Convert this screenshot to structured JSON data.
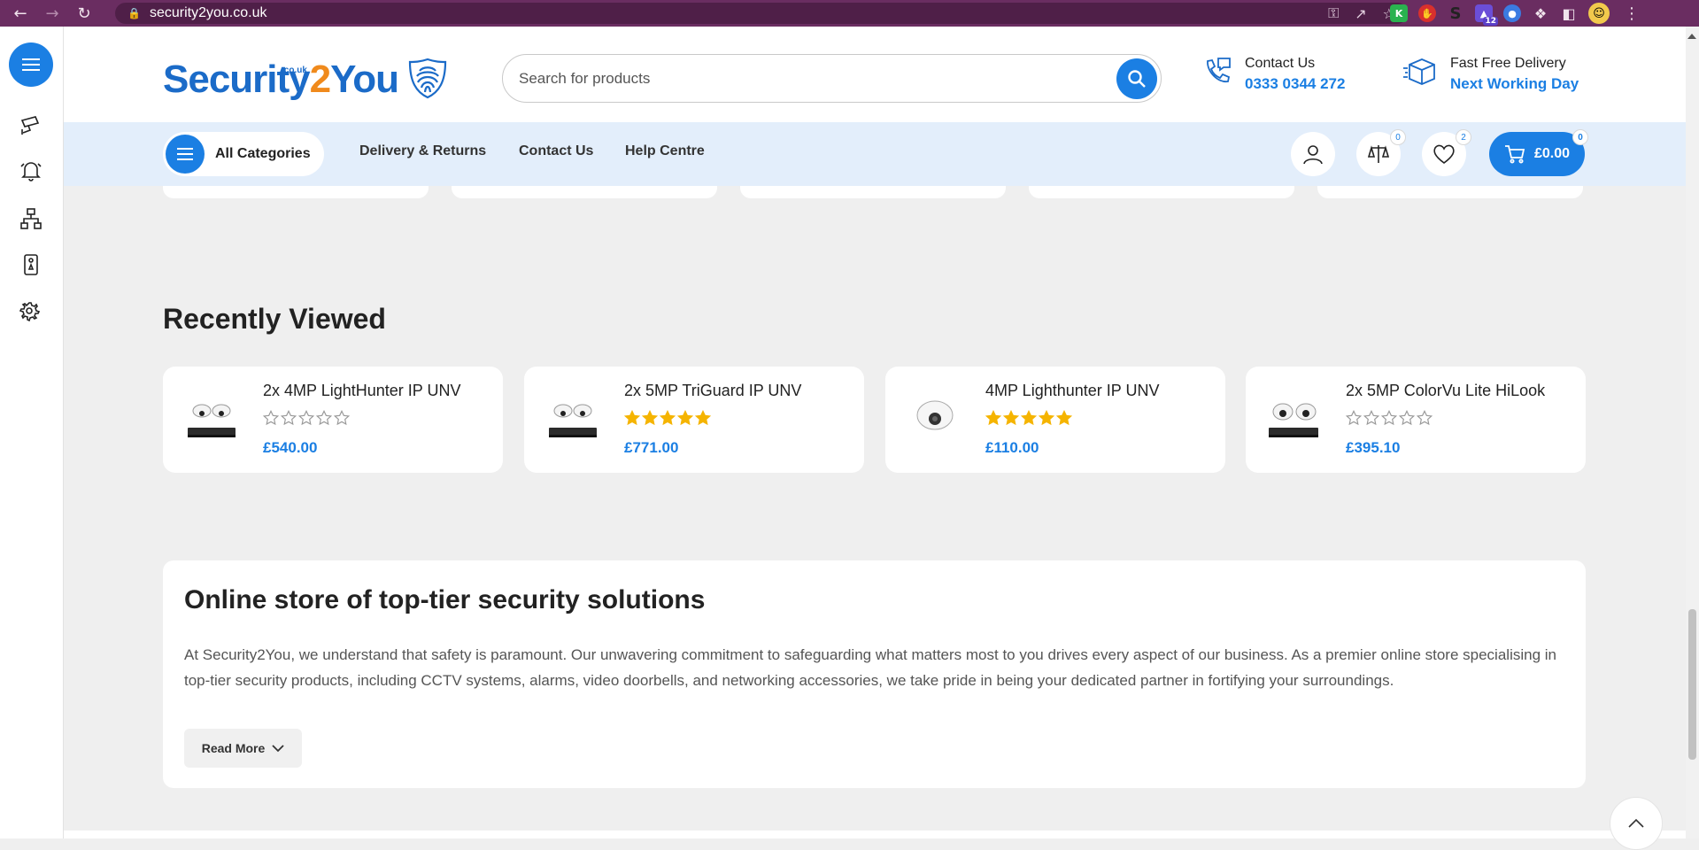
{
  "browser": {
    "url": "security2you.co.uk",
    "extension_badge": "12"
  },
  "header": {
    "logo_text_a": "Security",
    "logo_text_b": "2",
    "logo_text_c": "You",
    "logo_sub": ".co.uk",
    "search_placeholder": "Search for products",
    "contact_title": "Contact Us",
    "contact_phone": "0333 0344 272",
    "delivery_title": "Fast Free Delivery",
    "delivery_sub": "Next Working Day"
  },
  "nav": {
    "all_categories": "All Categories",
    "links": [
      "Delivery & Returns",
      "Contact Us",
      "Help Centre"
    ],
    "compare_count": "0",
    "wishlist_count": "2",
    "cart_total": "£0.00",
    "cart_count": "0"
  },
  "recently_viewed": {
    "title": "Recently Viewed",
    "items": [
      {
        "title": "2x 4MP LightHunter IP UNV",
        "price": "£540.00",
        "rating": 0
      },
      {
        "title": "2x 5MP TriGuard IP UNV",
        "price": "£771.00",
        "rating": 5
      },
      {
        "title": "4MP Lighthunter IP UNV",
        "price": "£110.00",
        "rating": 5
      },
      {
        "title": "2x 5MP ColorVu Lite HiLook",
        "price": "£395.10",
        "rating": 0
      }
    ]
  },
  "about": {
    "title": "Online store of top-tier security solutions",
    "text": "At Security2You, we understand that safety is paramount. Our unwavering commitment to safeguarding what matters most to you drives every aspect of our business. As a premier online store specialising in top-tier security products, including CCTV systems, alarms, video doorbells, and networking accessories, we take pride in being your dedicated partner in fortifying your surroundings.",
    "read_more": "Read More"
  },
  "colors": {
    "brand_blue": "#1b7fe3",
    "brand_orange": "#f08a1c",
    "chrome_purple": "#6a2d61",
    "star_gold": "#f5b400"
  }
}
